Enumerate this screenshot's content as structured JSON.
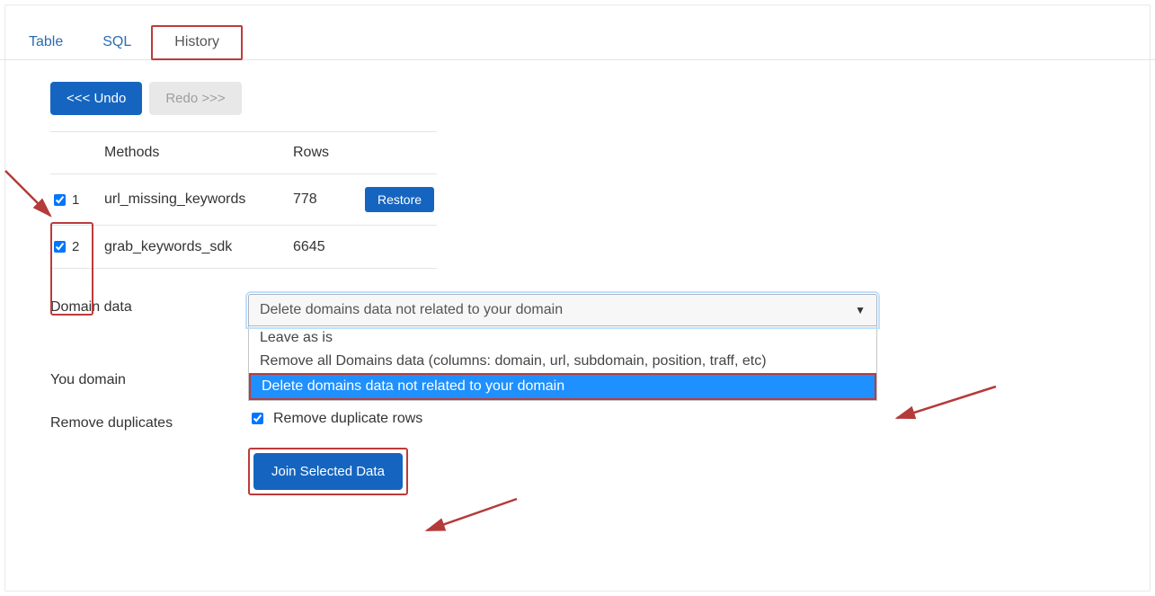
{
  "tabs": {
    "table": "Table",
    "sql": "SQL",
    "history": "History"
  },
  "buttons": {
    "undo": "<<< Undo",
    "redo": "Redo >>>",
    "restore": "Restore",
    "join": "Join Selected Data"
  },
  "table": {
    "headers": {
      "methods": "Methods",
      "rows": "Rows"
    },
    "rows": [
      {
        "idx": "1",
        "method": "url_missing_keywords",
        "rows": "778",
        "has_restore": true,
        "checked": true
      },
      {
        "idx": "2",
        "method": "grab_keywords_sdk",
        "rows": "6645",
        "has_restore": false,
        "checked": true
      }
    ]
  },
  "form": {
    "domain_data_label": "Domain data",
    "your_domain_label": "You domain",
    "remove_dup_label": "Remove duplicates",
    "remove_dup_check": "Remove duplicate rows",
    "select_value": "Delete domains data not related to your domain",
    "options": [
      "Leave as is",
      "Remove all Domains data (columns: domain, url, subdomain, position, traff, etc)",
      "Delete domains data not related to your domain"
    ]
  }
}
